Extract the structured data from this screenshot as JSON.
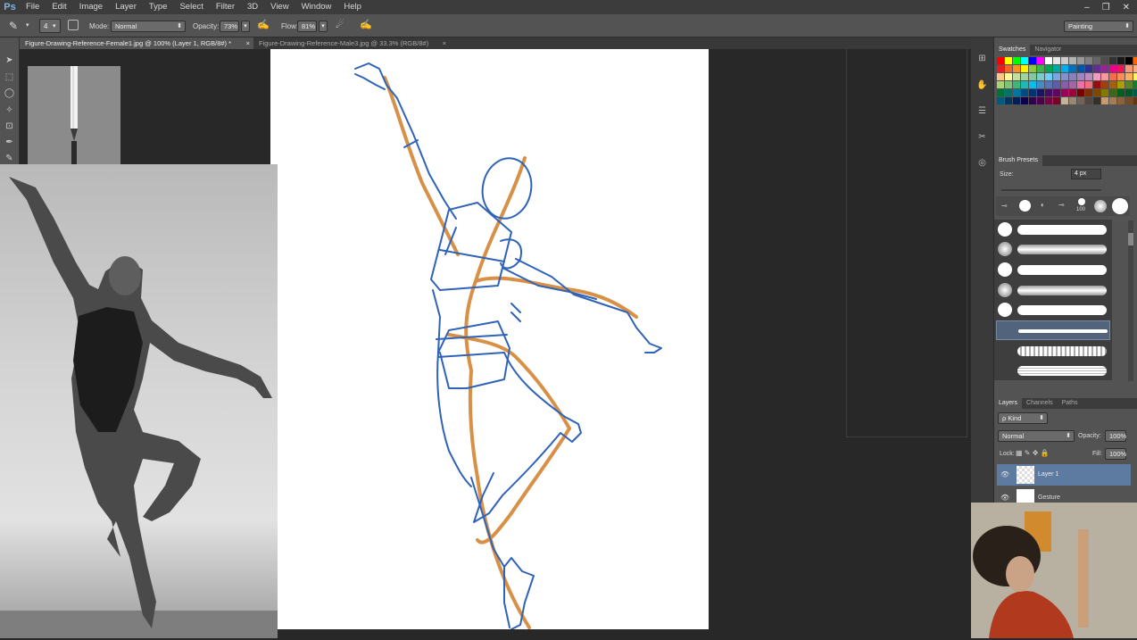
{
  "app": {
    "logo": "Ps"
  },
  "menu": [
    "File",
    "Edit",
    "Image",
    "Layer",
    "Type",
    "Select",
    "Filter",
    "3D",
    "View",
    "Window",
    "Help"
  ],
  "window_controls": [
    "–",
    "❐",
    "✕"
  ],
  "options": {
    "brush_size": "4",
    "mode_label": "Mode:",
    "mode_value": "Normal",
    "opacity_label": "Opacity:",
    "opacity_value": "73%",
    "flow_label": "Flow:",
    "flow_value": "81%",
    "workspace_value": "Painting"
  },
  "tabs": [
    {
      "label": "Figure-Drawing-Reference-Female1.jpg @ 100% (Layer 1, RGB/8#) *",
      "close": "×"
    },
    {
      "label": "Figure-Drawing-Reference-Male3.jpg @ 33.3% (RGB/8#)",
      "close": "×"
    }
  ],
  "panels": {
    "swatches_tab": "Swatches",
    "navigator_tab": "Navigator",
    "brush_presets_tab": "Brush Presets",
    "size_label": "Size:",
    "size_value": "4 px",
    "brush_tip_label": "100",
    "layers_tab": "Layers",
    "channels_tab": "Channels",
    "paths_tab": "Paths",
    "kind_value": "ρ Kind",
    "blend_value": "Normal",
    "layer_opacity_label": "Opacity:",
    "layer_opacity_value": "100%",
    "lock_label": "Lock:",
    "fill_label": "Fill:",
    "fill_value": "100%",
    "layers": [
      "Layer 1",
      "Gesture"
    ]
  },
  "colors": {
    "swatches": [
      "#ff0000",
      "#ffff00",
      "#00ff00",
      "#00ffff",
      "#0000ff",
      "#ff00ff",
      "#ffffff",
      "#e6e6e6",
      "#cccccc",
      "#b3b3b3",
      "#999999",
      "#808080",
      "#666666",
      "#4d4d4d",
      "#333333",
      "#1a1a1a",
      "#000000",
      "#ff6600",
      "#ed1c24",
      "#f26522",
      "#f7941d",
      "#fff200",
      "#8dc63f",
      "#39b54a",
      "#00a651",
      "#00a99d",
      "#00aeef",
      "#0072bc",
      "#0054a6",
      "#2e3192",
      "#662d91",
      "#92278f",
      "#ec008c",
      "#ed145b",
      "#f7977a",
      "#fbad82",
      "#fdc689",
      "#fff799",
      "#c4df9b",
      "#a3d39c",
      "#82ca9c",
      "#7accc8",
      "#6dcff6",
      "#7da7d9",
      "#8393ca",
      "#8781bd",
      "#a186be",
      "#bd8cbf",
      "#f49ac1",
      "#f6989d",
      "#f26c4f",
      "#f68e55",
      "#fbaf5c",
      "#fff467",
      "#acd372",
      "#7cc576",
      "#3bb878",
      "#1abbb4",
      "#00bff3",
      "#438ccb",
      "#5574b9",
      "#605ca8",
      "#855fa8",
      "#a763a8",
      "#f06ea9",
      "#f26d7d",
      "#9e0b0f",
      "#a0410d",
      "#a36209",
      "#aba000",
      "#598527",
      "#1a7b30",
      "#007236",
      "#00746b",
      "#0076a3",
      "#004b80",
      "#003471",
      "#1b1464",
      "#440e62",
      "#630460",
      "#9e005d",
      "#9e0039",
      "#790000",
      "#7b2e00",
      "#7d4900",
      "#827b00",
      "#406618",
      "#005e20",
      "#005826",
      "#005952",
      "#005b7f",
      "#003663",
      "#002157",
      "#0d004c",
      "#32004b",
      "#4b0049",
      "#7b0046",
      "#7a0026",
      "#c7b299",
      "#998675",
      "#736357",
      "#534741",
      "#37302a",
      "#c69c6d",
      "#a67c52",
      "#8c6239",
      "#754c24",
      "#603913"
    ],
    "canvas_bg": "#ffffff",
    "stroke_blue": "#2f63b8",
    "stroke_orange": "#d38433",
    "selected_layer": "#5d7aa0"
  },
  "icons": {
    "brush_tool": "✎",
    "tools": [
      "➤",
      "⬚",
      "◯",
      "✧",
      "⊡",
      "✒",
      "✎"
    ],
    "strip": [
      "⊞",
      "✋",
      "☰",
      "✂",
      "◎"
    ]
  }
}
